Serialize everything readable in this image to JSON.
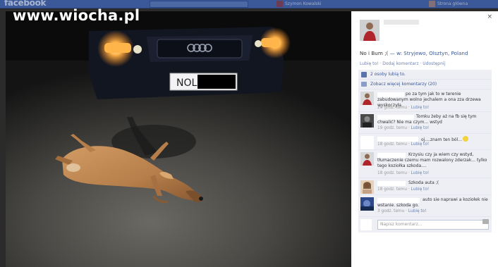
{
  "topbar": {
    "logo": "facebook",
    "profile_label": "Szymon Kowalski",
    "right_label": "Strona główna"
  },
  "watermark": "www.wiocha.pl",
  "photo": {
    "plate_text": "NOL"
  },
  "post": {
    "close": "×",
    "text_main": "No i Bum ;(",
    "text_location": " — w: Stryjewo, Olsztyn, Poland",
    "actions": "Lubię to! · Dodaj komentarz · Udostępnij",
    "likes": "2 osoby lubią to.",
    "more_comments": "Zobacz więcej komentarzy (20)"
  },
  "comments": [
    {
      "body": "po za tym jak to w terenie zabudowanym wolno jechalem a ona zza drzewa wyskoczyła",
      "time": "20 godz. temu",
      "like": "Lubię to!"
    },
    {
      "body": "Tomku żeby aż na fb się tym chwalić? Nie ma czym... wstyd",
      "time": "19 godz. temu",
      "like": "Lubię to!"
    },
    {
      "body": "oj....znam ten ból...",
      "time": "18 godz. temu",
      "like": "Lubię to!"
    },
    {
      "body": "Krzysiu czy ja wiem czy wstyd, tłumaczenie czemu mam rozwalony zderzak... tylko tego koziołka szkoda....",
      "time": "18 godz. temu",
      "like": "Lubię to!"
    },
    {
      "body": "Szkoda auta ;(",
      "time": "18 godz. temu",
      "like": "Lubię to!"
    },
    {
      "body": "auto sie naprawi a koziołek nie wstanie. szkoda go.",
      "time": "3 godz. temu",
      "like": "Lubię to!"
    }
  ],
  "composer": {
    "placeholder": "Napisz komentarz..."
  },
  "meta_separator": " · "
}
